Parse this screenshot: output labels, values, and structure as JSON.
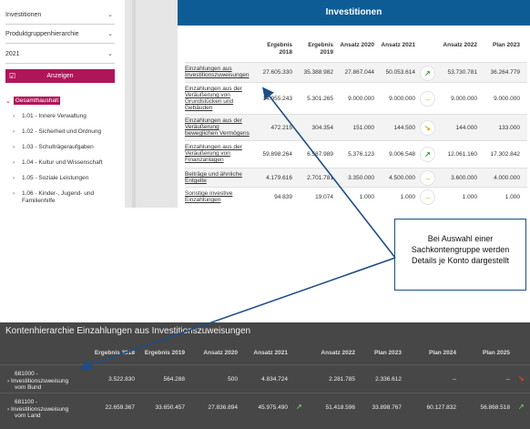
{
  "filters": {
    "haushalt": "Investitionen",
    "hierarchie": "Produktgruppenhierarchie",
    "jahr": "2021",
    "show_button": "Anzeigen"
  },
  "tree": {
    "root": "Gesamthaushalt",
    "items": [
      "1.01 - Innere Verwaltung",
      "1.02 - Sicherheit und Ordnung",
      "1.03 - Schulträgeraufgaben",
      "1.04 - Kultur und Wissenschaft",
      "1.05 - Soziale Leistungen",
      "1.06 - Kinder-, Jugend- und Familienhilfe"
    ]
  },
  "main": {
    "title": "Investitionen",
    "columns": [
      "Ergebnis 2018",
      "Ergebnis 2019",
      "Ansatz 2020",
      "Ansatz 2021",
      "Ansatz 2022",
      "Plan 2023"
    ],
    "rows": [
      {
        "label": "Einzahlungen aus Investitionszuweisungen",
        "values": [
          "27.605.330",
          "35.388.982",
          "27.867.044",
          "50.053.614",
          "53.730.781",
          "36.264.779"
        ],
        "trend": "up"
      },
      {
        "label": "Einzahlungen aus der Veräußerung von Grundstücken und Gebäuden",
        "values": [
          "14.955.243",
          "5.301.265",
          "9.000.000",
          "9.000.000",
          "9.000.000",
          "9.000.000"
        ],
        "trend": "right"
      },
      {
        "label": "Einzahlungen aus der Veräußerung beweglichen Vermögens",
        "values": [
          "472.215",
          "304.354",
          "151.000",
          "144.500",
          "144.000",
          "133.000"
        ],
        "trend": "down"
      },
      {
        "label": "Einzahlungen aus der Veräußerung von Finanzanlagen",
        "values": [
          "59.898.264",
          "6.587.989",
          "5.376.123",
          "9.006.548",
          "12.061.160",
          "17.302.842"
        ],
        "trend": "up"
      },
      {
        "label": "Beiträge und ähnliche Entgelte",
        "values": [
          "4.179.616",
          "2.701.781",
          "3.350.000",
          "4.500.000",
          "3.600.000",
          "4.000.000"
        ],
        "trend": "right"
      },
      {
        "label": "Sonstige investive Einzahlungen",
        "values": [
          "94.839",
          "19.074",
          "1.000",
          "1.000",
          "1.000",
          "1.000"
        ],
        "trend": "right"
      }
    ]
  },
  "callout": {
    "line1": "Bei Auswahl einer",
    "line2": "Sachkontengruppe werden",
    "line3": "Details je Konto dargestellt"
  },
  "bottom": {
    "title": "Kontenhierarchie Einzahlungen aus Investitionszuweisungen",
    "columns": [
      "Ergebnis 2018",
      "Ergebnis 2019",
      "Ansatz 2020",
      "Ansatz 2021",
      "Ansatz 2022",
      "Plan 2023",
      "Plan 2024",
      "Plan 2025"
    ],
    "rows": [
      {
        "label_line1": "681000 -",
        "label_line2": "Investitionszuweisung",
        "label_line3": "vom Bund",
        "values": [
          "3.522.830",
          "564.288",
          "500",
          "4.834.724",
          "2.281.785",
          "2.336.612",
          "--",
          "--"
        ],
        "trend": "down"
      },
      {
        "label_line1": "681100 -",
        "label_line2": "Investitionszuweisung",
        "label_line3": "vom Land",
        "values": [
          "22.659.367",
          "33.650.457",
          "27.836.894",
          "45.975.490",
          "51.418.596",
          "33.898.767",
          "60.127.832",
          "56.868.518"
        ],
        "trend": "up"
      }
    ]
  },
  "colors": {
    "header_blue": "#0d5c96",
    "accent_magenta": "#b0155a",
    "trend_up": "#3a9a3a",
    "trend_neutral": "#f29a1a",
    "bottom_bg": "#474747"
  }
}
